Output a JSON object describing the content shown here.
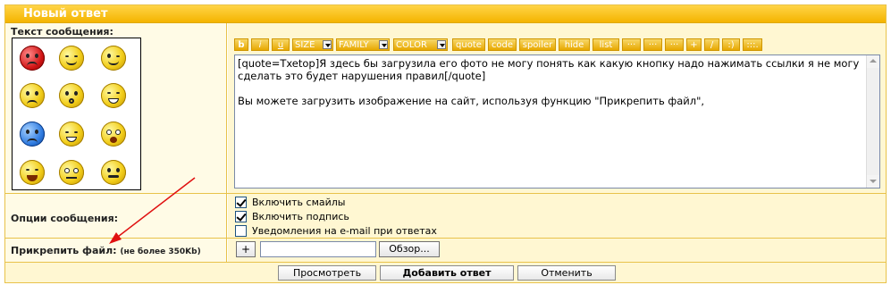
{
  "header": {
    "title": "Новый ответ"
  },
  "message_row": {
    "label": "Текст сообщения:",
    "smileys": [
      {
        "name": "angry",
        "color": "red"
      },
      {
        "name": "smile",
        "color": "yellow"
      },
      {
        "name": "wink-finger",
        "color": "yellow"
      },
      {
        "name": "sad",
        "color": "yellow"
      },
      {
        "name": "surprised",
        "color": "yellow"
      },
      {
        "name": "grin",
        "color": "yellow"
      },
      {
        "name": "cry",
        "color": "blue"
      },
      {
        "name": "happy",
        "color": "yellow"
      },
      {
        "name": "shocked",
        "color": "yellow"
      },
      {
        "name": "laugh",
        "color": "yellow"
      },
      {
        "name": "confused",
        "color": "yellow"
      },
      {
        "name": "mustache",
        "color": "yellow"
      }
    ],
    "toolbar": {
      "bold": "b",
      "italic": "i",
      "underline": "u",
      "size": "SIZE",
      "family": "FAMILY",
      "color": "COLOR",
      "quote": "quote",
      "code": "code",
      "spoiler": "spoiler",
      "hide": "hide",
      "list": "list",
      "dots1": "···",
      "dots2": "···",
      "dots3": "···",
      "plus": "+",
      "slash": "/",
      "smile": ":)",
      "more": ":::."
    },
    "textarea": {
      "line1": "[quote=Txetop]Я здесь бы загрузила его фото не могу понять как какую кнопку надо нажимать ссылки я не могу сделать это будет нарушения правил[/quote]",
      "line2": "Вы можете загрузить изображение на сайт, используя функцию \"Прикрепить файл\","
    }
  },
  "options_row": {
    "label": "Опции сообщения:",
    "options": [
      {
        "label": "Включить смайлы",
        "checked": true
      },
      {
        "label": "Включить подпись",
        "checked": true
      },
      {
        "label": "Уведомления на e-mail при ответах",
        "checked": false
      }
    ]
  },
  "attach_row": {
    "label": "Прикрепить файл:",
    "hint": "(не более 350Kb)",
    "plus": "+",
    "browse": "Обзор..."
  },
  "actions": {
    "preview": "Просмотреть",
    "submit": "Добавить ответ",
    "cancel": "Отменить"
  },
  "colors": {
    "accent": "#f4b400",
    "row_bg": "#fff7d2",
    "left_bg": "#fffbe6",
    "border": "#e8c24a",
    "arrow": "#e01010"
  }
}
